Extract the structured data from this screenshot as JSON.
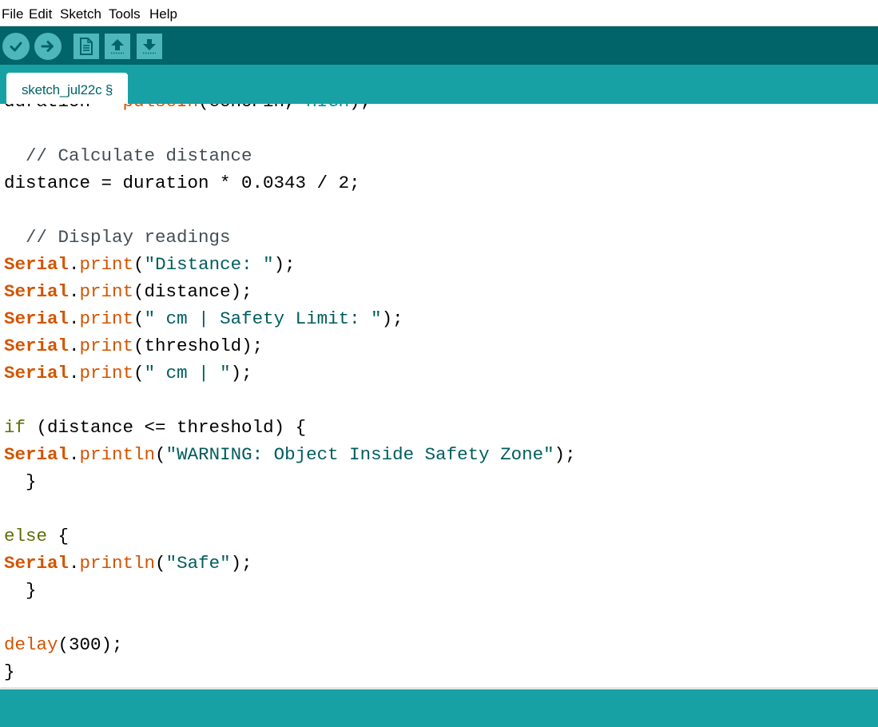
{
  "menu": {
    "file": "File",
    "edit": "Edit",
    "sketch": "Sketch",
    "tools": "Tools",
    "help": "Help"
  },
  "toolbar": {
    "verify_icon": "checkmark-icon",
    "upload_icon": "arrow-right-icon",
    "new_icon": "document-icon",
    "open_icon": "arrow-up-icon",
    "save_icon": "arrow-down-icon"
  },
  "tab": {
    "label": "sketch_jul22c §"
  },
  "colors": {
    "toolbar_bg": "#006468",
    "tab_strip_bg": "#17a1a5",
    "button_bg": "#4db7bb",
    "keyword": "#d35400",
    "string": "#005c5f",
    "comment": "#434f54",
    "control": "#5e6d03"
  },
  "code": {
    "line0": {
      "a": "duration = ",
      "b": "pulseIn",
      "c": "(echoPin, ",
      "d": "HIGH",
      "e": ");"
    },
    "line2": {
      "a": "  // Calculate distance"
    },
    "line3": {
      "a": "distance = duration * 0.0343 / 2;"
    },
    "line5": {
      "a": "  // Display readings"
    },
    "line6": {
      "a": "Serial",
      "b": ".",
      "c": "print",
      "d": "(",
      "e": "\"Distance: \"",
      "f": ");"
    },
    "line7": {
      "a": "Serial",
      "b": ".",
      "c": "print",
      "d": "(distance);"
    },
    "line8": {
      "a": "Serial",
      "b": ".",
      "c": "print",
      "d": "(",
      "e": "\" cm | Safety Limit: \"",
      "f": ");"
    },
    "line9": {
      "a": "Serial",
      "b": ".",
      "c": "print",
      "d": "(threshold);"
    },
    "line10": {
      "a": "Serial",
      "b": ".",
      "c": "print",
      "d": "(",
      "e": "\" cm | \"",
      "f": ");"
    },
    "line12": {
      "a": "if",
      "b": " (distance <= threshold) {"
    },
    "line13": {
      "a": "Serial",
      "b": ".",
      "c": "println",
      "d": "(",
      "e": "\"WARNING: Object Inside Safety Zone\"",
      "f": ");"
    },
    "line14": {
      "a": "  }"
    },
    "line16": {
      "a": "else",
      "b": " {"
    },
    "line17": {
      "a": "Serial",
      "b": ".",
      "c": "println",
      "d": "(",
      "e": "\"Safe\"",
      "f": ");"
    },
    "line18": {
      "a": "  }"
    },
    "line20": {
      "a": "delay",
      "b": "(300);"
    },
    "line21": {
      "a": "}"
    }
  }
}
